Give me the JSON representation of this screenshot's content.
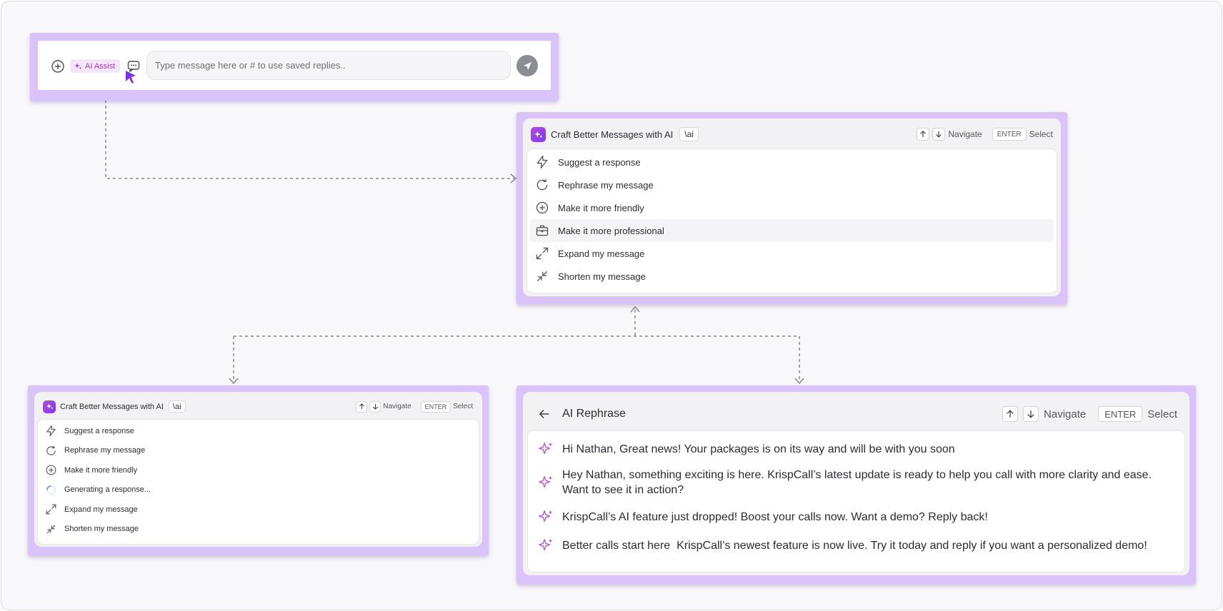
{
  "composer": {
    "ai_assist_label": "AI Assist",
    "input_placeholder": "Type message here or # to use saved replies.."
  },
  "ai_menu": {
    "title": "Craft Better Messages with AI",
    "shortcut": "\\ai",
    "navigate_label": "Navigate",
    "enter_key": "ENTER",
    "select_label": "Select",
    "options": [
      {
        "label": "Suggest a response",
        "icon": "lightning-icon"
      },
      {
        "label": "Rephrase my message",
        "icon": "refresh-icon"
      },
      {
        "label": "Make it more friendly",
        "icon": "plus-circle-icon"
      },
      {
        "label": "Make it more professional",
        "icon": "briefcase-icon"
      },
      {
        "label": "Expand my message",
        "icon": "expand-icon"
      },
      {
        "label": "Shorten my message",
        "icon": "shorten-icon"
      }
    ],
    "highlighted_option": "Make it more professional"
  },
  "ai_menu_generating": {
    "title": "Craft Better Messages with AI",
    "shortcut": "\\ai",
    "navigate_label": "Navigate",
    "enter_key": "ENTER",
    "select_label": "Select",
    "options": [
      {
        "label": "Suggest a response",
        "icon": "lightning-icon"
      },
      {
        "label": "Rephrase my message",
        "icon": "refresh-icon"
      },
      {
        "label": "Make it more friendly",
        "icon": "plus-circle-icon"
      },
      {
        "label": "Generating a response...",
        "icon": "spinner-icon"
      },
      {
        "label": "Expand my message",
        "icon": "expand-icon"
      },
      {
        "label": "Shorten my message",
        "icon": "shorten-icon"
      }
    ]
  },
  "ai_rephrase": {
    "title": "AI Rephrase",
    "navigate_label": "Navigate",
    "enter_key": "ENTER",
    "select_label": "Select",
    "suggestions": [
      "Hi Nathan, Great news! Your packages is on its way and will be with you soon",
      "Hey Nathan, something exciting is here. KrispCall’s latest update is ready to help you call with more clarity and ease. Want to see it in action?",
      "KrispCall’s AI feature just dropped! Boost your calls now. Want a demo? Reply back!",
      "Better calls start here  KrispCall’s newest feature is now live. Try it today and reply if you want a personalized demo!"
    ]
  },
  "colors": {
    "frame": "#d9c3f8",
    "accent": "#a03ec4",
    "cursor": "#7b2ff0",
    "background": "#f8f8fb"
  }
}
